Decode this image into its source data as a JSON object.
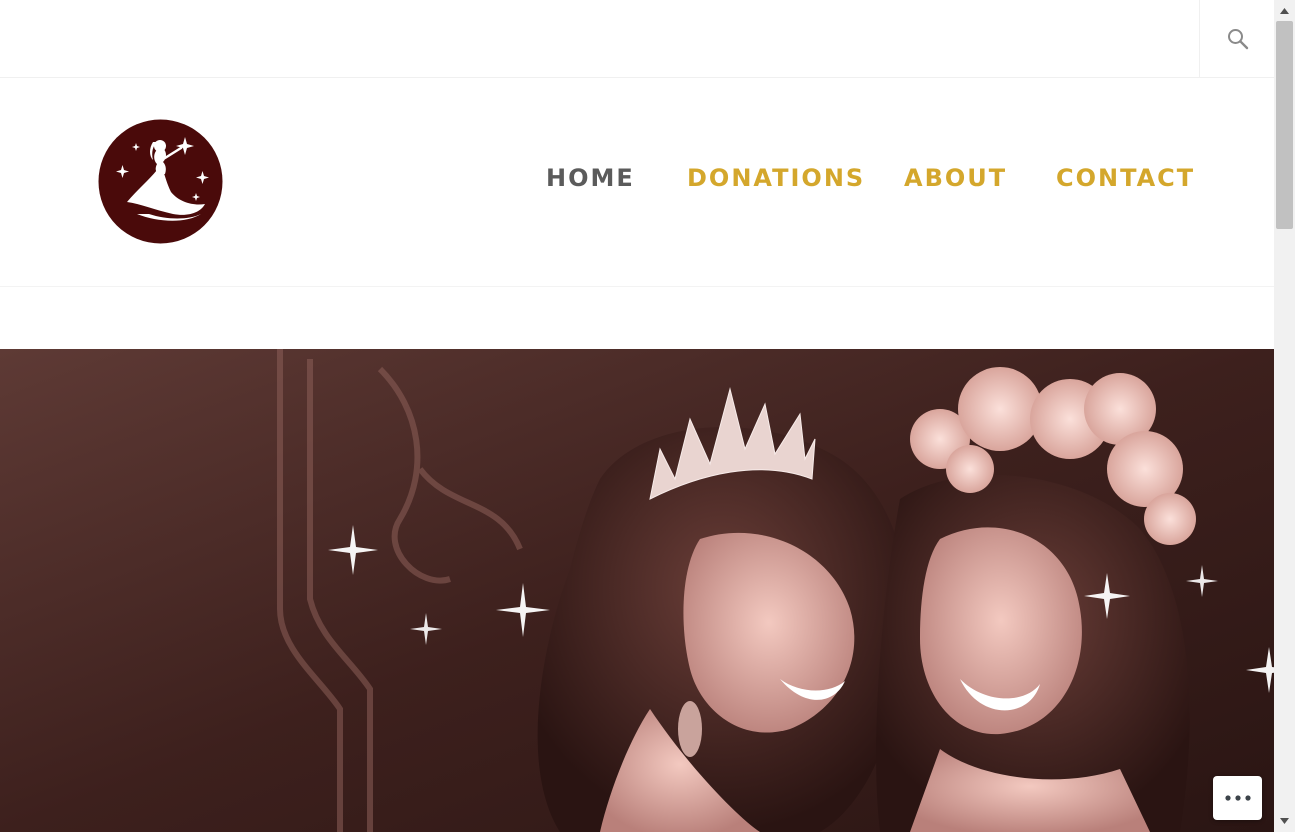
{
  "nav": {
    "items": [
      {
        "label": "HOME",
        "active": true
      },
      {
        "label": "DONATIONS",
        "active": false
      },
      {
        "label": "ABOUT",
        "active": false
      },
      {
        "label": "CONTACT",
        "active": false
      }
    ]
  },
  "icons": {
    "search": "search-icon",
    "logo": "princess-silhouette-logo",
    "more": "more-horizontal-icon",
    "scroll_up": "arrow-up-icon",
    "scroll_down": "arrow-down-icon"
  },
  "colors": {
    "nav_active": "#5b5b5b",
    "nav_link": "#d4a72c",
    "logo_bg": "#4a0a0a",
    "hero_tint": "#4a2a26"
  }
}
